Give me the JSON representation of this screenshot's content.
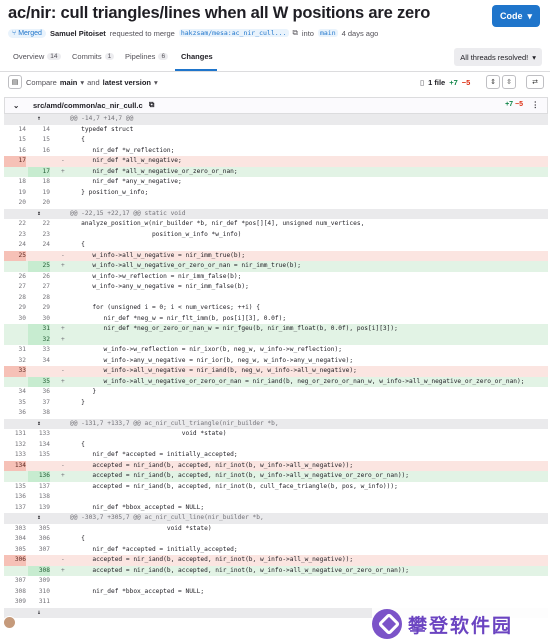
{
  "title": "ac/nir: cull triangles/lines when all W positions are zero",
  "code_button": "Code",
  "meta": {
    "status": "Merged",
    "author": "Samuel Pitoiset",
    "requested_text": "requested to merge",
    "source_branch": "hakzsam/mesa:ac_nir_cull...",
    "into_text": "into",
    "target_branch": "main",
    "time": "4 days ago"
  },
  "tabs": [
    {
      "label": "Overview",
      "count": "14"
    },
    {
      "label": "Commits",
      "count": "1"
    },
    {
      "label": "Pipelines",
      "count": "6"
    },
    {
      "label": "Changes",
      "count": ""
    }
  ],
  "threads_button": "All threads resolved!",
  "toolbar": {
    "compare": "Compare",
    "base": "main",
    "and": "and",
    "latest": "latest version",
    "file_count": "1 file",
    "added": "+7",
    "removed": "−5"
  },
  "file": {
    "path": "src/amd/common/ac_nir_cull.c",
    "added": "+7",
    "removed": "−5"
  },
  "lines": [
    {
      "t": "hunk",
      "exp": "↑",
      "code": "@@ -14,7 +14,7 @@"
    },
    {
      "t": "ctx",
      "o": "14",
      "n": "14",
      "code": "   typedef struct"
    },
    {
      "t": "ctx",
      "o": "15",
      "n": "15",
      "code": "   {"
    },
    {
      "t": "ctx",
      "o": "16",
      "n": "16",
      "code": "      nir_def *w_reflection;"
    },
    {
      "t": "del",
      "o": "17",
      "n": "",
      "code": "      nir_def *all_w_negative;"
    },
    {
      "t": "add",
      "o": "",
      "n": "17",
      "code": "      nir_def *all_w_negative_or_zero_or_nan;"
    },
    {
      "t": "ctx",
      "o": "18",
      "n": "18",
      "code": "      nir_def *any_w_negative;"
    },
    {
      "t": "ctx",
      "o": "19",
      "n": "19",
      "code": "   } position_w_info;"
    },
    {
      "t": "ctx",
      "o": "20",
      "n": "20",
      "code": ""
    },
    {
      "t": "hunk",
      "exp": "↕",
      "code": "@@ -22,15 +22,17 @@ static void"
    },
    {
      "t": "ctx",
      "o": "22",
      "n": "22",
      "code": "   analyze_position_w(nir_builder *b, nir_def *pos[][4], unsigned num_vertices,"
    },
    {
      "t": "ctx",
      "o": "23",
      "n": "23",
      "code": "                      position_w_info *w_info)"
    },
    {
      "t": "ctx",
      "o": "24",
      "n": "24",
      "code": "   {"
    },
    {
      "t": "del",
      "o": "25",
      "n": "",
      "code": "      w_info->all_w_negative = nir_imm_true(b);"
    },
    {
      "t": "add",
      "o": "",
      "n": "25",
      "code": "      w_info->all_w_negative_or_zero_or_nan = nir_imm_true(b);"
    },
    {
      "t": "ctx",
      "o": "26",
      "n": "26",
      "code": "      w_info->w_reflection = nir_imm_false(b);"
    },
    {
      "t": "ctx",
      "o": "27",
      "n": "27",
      "code": "      w_info->any_w_negative = nir_imm_false(b);"
    },
    {
      "t": "ctx",
      "o": "28",
      "n": "28",
      "code": ""
    },
    {
      "t": "ctx",
      "o": "29",
      "n": "29",
      "code": "      for (unsigned i = 0; i < num_vertices; ++i) {"
    },
    {
      "t": "ctx",
      "o": "30",
      "n": "30",
      "code": "         nir_def *neg_w = nir_flt_imm(b, pos[i][3], 0.0f);"
    },
    {
      "t": "add",
      "o": "",
      "n": "31",
      "code": "         nir_def *neg_or_zero_or_nan_w = nir_fgeu(b, nir_imm_float(b, 0.0f), pos[i][3]);"
    },
    {
      "t": "add",
      "o": "",
      "n": "32",
      "code": ""
    },
    {
      "t": "ctx",
      "o": "31",
      "n": "33",
      "code": "         w_info->w_reflection = nir_ixor(b, neg_w, w_info->w_reflection);"
    },
    {
      "t": "ctx",
      "o": "32",
      "n": "34",
      "code": "         w_info->any_w_negative = nir_ior(b, neg_w, w_info->any_w_negative);"
    },
    {
      "t": "del",
      "o": "33",
      "n": "",
      "code": "         w_info->all_w_negative = nir_iand(b, neg_w, w_info->all_w_negative);"
    },
    {
      "t": "add",
      "o": "",
      "n": "35",
      "code": "         w_info->all_w_negative_or_zero_or_nan = nir_iand(b, neg_or_zero_or_nan_w, w_info->all_w_negative_or_zero_or_nan);"
    },
    {
      "t": "ctx",
      "o": "34",
      "n": "36",
      "code": "      }"
    },
    {
      "t": "ctx",
      "o": "35",
      "n": "37",
      "code": "   }"
    },
    {
      "t": "ctx",
      "o": "36",
      "n": "38",
      "code": ""
    },
    {
      "t": "hunk",
      "exp": "↕",
      "code": "@@ -131,7 +133,7 @@ ac_nir_cull_triangle(nir_builder *b,"
    },
    {
      "t": "ctx",
      "o": "131",
      "n": "133",
      "code": "                              void *state)"
    },
    {
      "t": "ctx",
      "o": "132",
      "n": "134",
      "code": "   {"
    },
    {
      "t": "ctx",
      "o": "133",
      "n": "135",
      "code": "      nir_def *accepted = initially_accepted;"
    },
    {
      "t": "del",
      "o": "134",
      "n": "",
      "code": "      accepted = nir_iand(b, accepted, nir_inot(b, w_info->all_w_negative));"
    },
    {
      "t": "add",
      "o": "",
      "n": "136",
      "code": "      accepted = nir_iand(b, accepted, nir_inot(b, w_info->all_w_negative_or_zero_or_nan));"
    },
    {
      "t": "ctx",
      "o": "135",
      "n": "137",
      "code": "      accepted = nir_iand(b, accepted, nir_inot(b, cull_face_triangle(b, pos, w_info)));"
    },
    {
      "t": "ctx",
      "o": "136",
      "n": "138",
      "code": ""
    },
    {
      "t": "ctx",
      "o": "137",
      "n": "139",
      "code": "      nir_def *bbox_accepted = NULL;"
    },
    {
      "t": "hunk",
      "exp": "↕",
      "code": "@@ -303,7 +305,7 @@ ac_nir_cull_line(nir_builder *b,"
    },
    {
      "t": "ctx",
      "o": "303",
      "n": "305",
      "code": "                          void *state)"
    },
    {
      "t": "ctx",
      "o": "304",
      "n": "306",
      "code": "   {"
    },
    {
      "t": "ctx",
      "o": "305",
      "n": "307",
      "code": "      nir_def *accepted = initially_accepted;"
    },
    {
      "t": "del",
      "o": "306",
      "n": "",
      "code": "      accepted = nir_iand(b, accepted, nir_inot(b, w_info->all_w_negative));"
    },
    {
      "t": "add",
      "o": "",
      "n": "308",
      "code": "      accepted = nir_iand(b, accepted, nir_inot(b, w_info->all_w_negative_or_zero_or_nan));"
    },
    {
      "t": "ctx",
      "o": "307",
      "n": "309",
      "code": ""
    },
    {
      "t": "ctx",
      "o": "308",
      "n": "310",
      "code": "      nir_def *bbox_accepted = NULL;"
    },
    {
      "t": "ctx",
      "o": "309",
      "n": "311",
      "code": ""
    },
    {
      "t": "hunk",
      "exp": "↓",
      "code": ""
    }
  ],
  "watermark": "攀登软件园",
  "colors": {
    "accent": "#1f75cb",
    "added": "#108548",
    "removed": "#dd2b0e"
  }
}
